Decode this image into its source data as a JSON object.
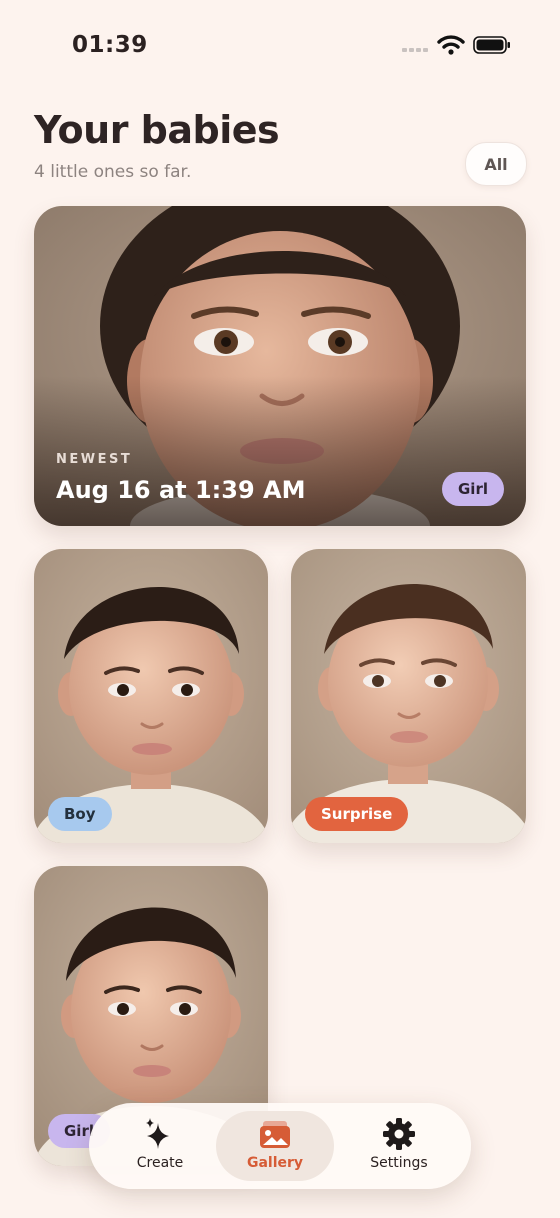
{
  "status": {
    "time": "01:39"
  },
  "header": {
    "title": "Your babies",
    "subtitle": "4 little ones so far.",
    "filter_label": "All"
  },
  "babies": [
    {
      "kicker": "NEWEST",
      "date": "Aug 16 at 1:39 AM",
      "tag": "Girl"
    },
    {
      "tag": "Boy"
    },
    {
      "tag": "Surprise"
    },
    {
      "tag": "Girl"
    }
  ],
  "nav": {
    "items": [
      {
        "label": "Create",
        "icon": "sparkles-icon"
      },
      {
        "label": "Gallery",
        "icon": "gallery-icon",
        "active": true
      },
      {
        "label": "Settings",
        "icon": "gear-icon"
      }
    ]
  },
  "colors": {
    "accent": "#d65c36",
    "girl": "#c8b6ee",
    "boy": "#a7c9ee",
    "surprise": "#e2643f",
    "background": "#fdf3ee"
  }
}
